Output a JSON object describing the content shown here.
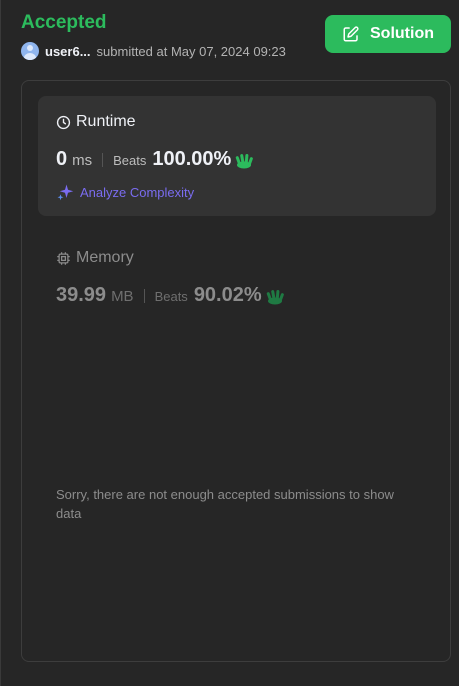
{
  "header": {
    "status": "Accepted",
    "username": "user6...",
    "submitted_text": "submitted at May 07, 2024 09:23",
    "solution_label": "Solution"
  },
  "runtime": {
    "title": "Runtime",
    "value": "0",
    "unit": "ms",
    "beats_label": "Beats",
    "percentile": "100.00%",
    "analyze_label": "Analyze Complexity"
  },
  "memory": {
    "title": "Memory",
    "value": "39.99",
    "unit": "MB",
    "beats_label": "Beats",
    "percentile": "90.02%"
  },
  "chart_message": "Sorry, there are not enough accepted submissions to show data",
  "colors": {
    "accent_green": "#2cbb5d",
    "background": "#262626",
    "card_bg": "#333333",
    "analyze_purple": "#7a6cf0"
  },
  "icons": {
    "edit": "edit-icon",
    "clock": "clock-icon",
    "cpu": "cpu-chip-icon",
    "sparkle": "sparkle-icon",
    "clap": "clapping-hands-icon"
  }
}
